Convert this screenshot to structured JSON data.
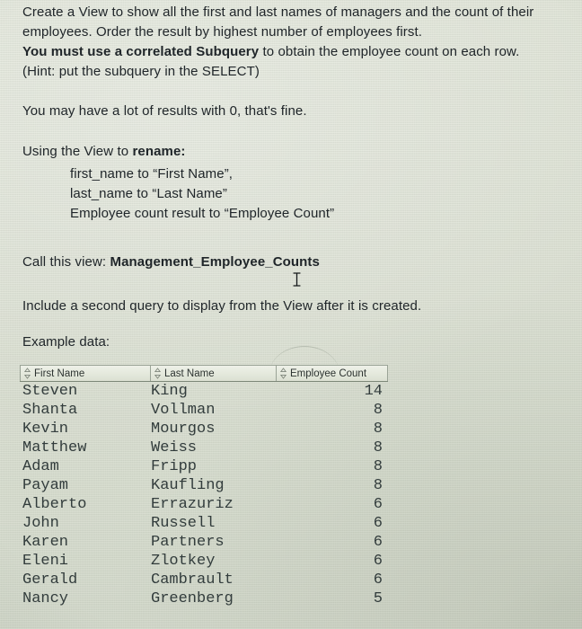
{
  "document": {
    "paragraphs": [
      {
        "id": "p1l1",
        "text": "Create a View to show all the first and last names of managers and the count of their"
      },
      {
        "id": "p1l2",
        "text": "employees. Order the result by highest number of employees first."
      },
      {
        "id": "p1l3_bold",
        "text": "You must use a correlated Subquery"
      },
      {
        "id": "p1l3_rest",
        "text": " to obtain the employee count on each row."
      },
      {
        "id": "p1l4",
        "text": "(Hint: put the subquery in the SELECT)"
      },
      {
        "id": "p2",
        "text": "You may have a lot of results with 0, that's fine."
      },
      {
        "id": "p3_lead",
        "text": "Using the View to "
      },
      {
        "id": "p3_bold",
        "text": "rename:"
      },
      {
        "id": "rename1",
        "text": "first_name to “First Name”,"
      },
      {
        "id": "rename2",
        "text": "last_name to “Last Name”"
      },
      {
        "id": "rename3",
        "text": "Employee count result to “Employee Count”"
      },
      {
        "id": "p4_lead",
        "text": "Call this view: "
      },
      {
        "id": "p4_bold",
        "text": "Management_Employee_Counts"
      },
      {
        "id": "p5",
        "text": "Include a second query to display from the View after it is created."
      },
      {
        "id": "p6",
        "text": "Example data:"
      }
    ]
  },
  "result_grid": {
    "columns": [
      {
        "key": "first_name",
        "label": "First Name",
        "icon": "sort-updown-icon"
      },
      {
        "key": "last_name",
        "label": "Last Name",
        "icon": "sort-updown-icon"
      },
      {
        "key": "employee_count",
        "label": "Employee Count",
        "icon": "sort-updown-icon"
      }
    ],
    "rows": [
      {
        "first_name": "Steven",
        "last_name": "King",
        "employee_count": "14"
      },
      {
        "first_name": "Shanta",
        "last_name": "Vollman",
        "employee_count": "8"
      },
      {
        "first_name": "Kevin",
        "last_name": "Mourgos",
        "employee_count": "8"
      },
      {
        "first_name": "Matthew",
        "last_name": "Weiss",
        "employee_count": "8"
      },
      {
        "first_name": "Adam",
        "last_name": "Fripp",
        "employee_count": "8"
      },
      {
        "first_name": "Payam",
        "last_name": "Kaufling",
        "employee_count": "8"
      },
      {
        "first_name": "Alberto",
        "last_name": "Errazuriz",
        "employee_count": "6"
      },
      {
        "first_name": "John",
        "last_name": "Russell",
        "employee_count": "6"
      },
      {
        "first_name": "Karen",
        "last_name": "Partners",
        "employee_count": "6"
      },
      {
        "first_name": "Eleni",
        "last_name": "Zlotkey",
        "employee_count": "6"
      },
      {
        "first_name": "Gerald",
        "last_name": "Cambrault",
        "employee_count": "6"
      },
      {
        "first_name": "Nancy",
        "last_name": "Greenberg",
        "employee_count": "5"
      }
    ]
  },
  "cursor": {
    "type": "text-ibeam-cursor"
  },
  "colors": {
    "page_background": "#dfe3d7",
    "body_text": "#20262a",
    "grid_text": "#323c3c",
    "grid_border": "#9aa396",
    "grid_header_background": "#e4e8dc"
  }
}
